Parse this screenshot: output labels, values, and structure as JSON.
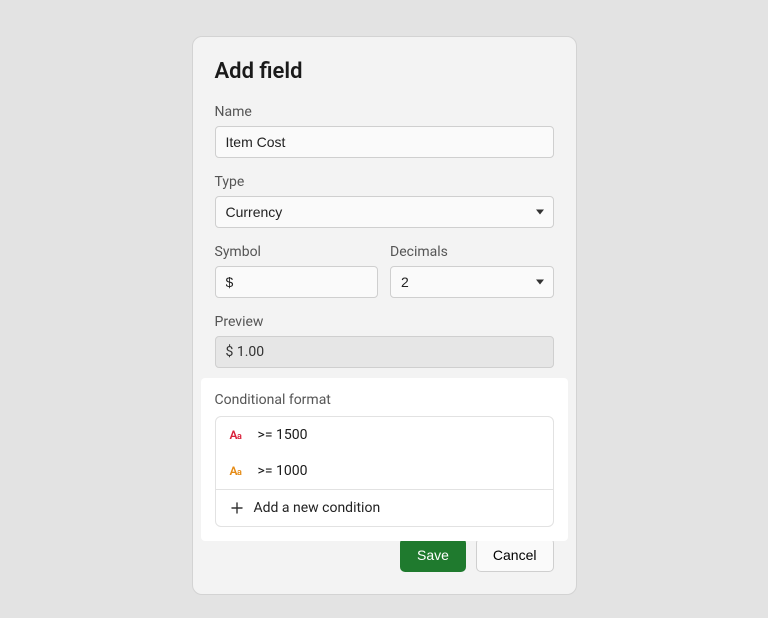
{
  "dialog": {
    "title": "Add field",
    "name": {
      "label": "Name",
      "value": "Item Cost"
    },
    "type": {
      "label": "Type",
      "value": "Currency"
    },
    "symbol": {
      "label": "Symbol",
      "value": "$"
    },
    "decimals": {
      "label": "Decimals",
      "value": "2"
    },
    "preview": {
      "label": "Preview",
      "value": "$ 1.00"
    },
    "conditional": {
      "label": "Conditional format",
      "rules": [
        {
          "color": "#d9203a",
          "text": ">= 1500"
        },
        {
          "color": "#e58a13",
          "text": ">= 1000"
        }
      ],
      "add_label": "Add a new condition"
    },
    "buttons": {
      "save": "Save",
      "cancel": "Cancel"
    }
  }
}
